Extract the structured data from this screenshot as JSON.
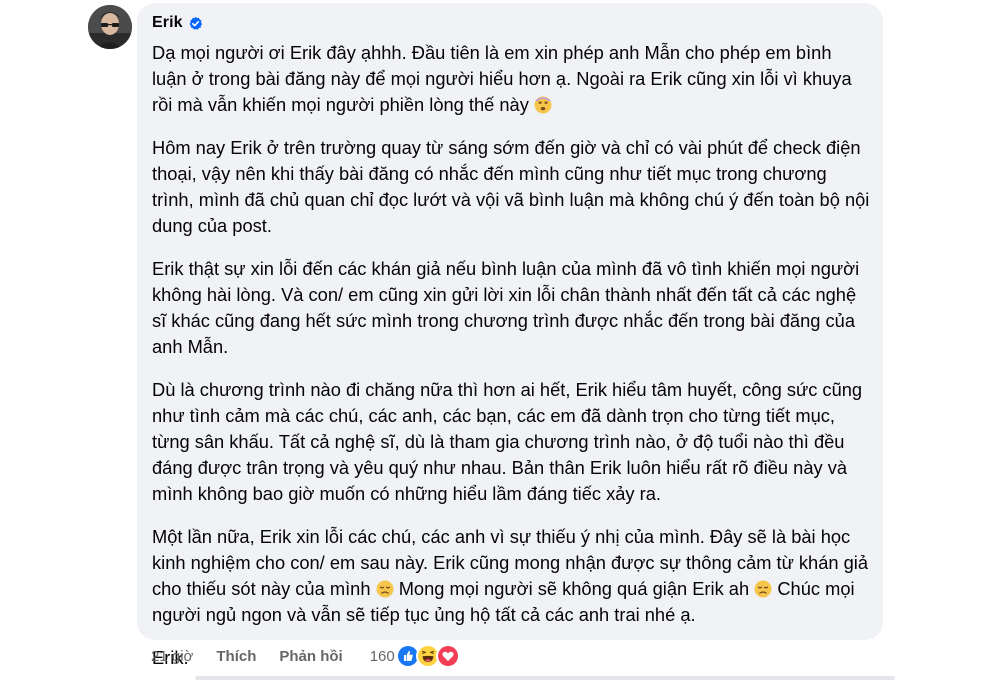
{
  "comment": {
    "author": "Erik",
    "verified": true,
    "paragraphs": {
      "p1": "Dạ mọi người ơi Erik đây ạhhh. Đầu tiên là em xin phép anh Mẫn cho phép em bình luận ở trong bài đăng này để mọi người hiểu hơn ạ. Ngoài ra Erik cũng xin lỗi vì khuya rồi mà vẫn khiến mọi người phiền lòng thế này",
      "p2": "Hôm nay Erik ở trên trường quay từ sáng sớm đến giờ và chỉ có vài phút để check điện thoại, vậy nên khi thấy bài đăng có nhắc đến mình cũng như tiết mục trong chương trình, mình đã chủ quan chỉ đọc lướt và vội vã bình luận mà không chú ý đến toàn bộ nội dung của post.",
      "p3": "Erik thật sự xin lỗi đến các khán giả nếu bình luận của mình đã vô tình khiến mọi người không hài lòng. Và con/ em cũng xin gửi lời xin lỗi chân thành nhất đến tất cả các nghệ sĩ khác cũng đang hết sức mình trong chương trình được nhắc đến trong bài đăng của anh Mẫn.",
      "p4": "Dù là chương trình nào đi chăng nữa thì hơn ai hết, Erik hiểu tâm huyết, công sức cũng như tình cảm mà các chú, các anh, các bạn, các em đã dành trọn cho từng tiết mục, từng sân khấu. Tất cả nghệ sĩ, dù là tham gia chương trình nào, ở độ tuổi nào thì đều đáng được trân trọng và yêu quý như nhau. Bản thân Erik luôn hiểu rất rõ điều này và mình không bao giờ muốn có những hiểu lầm đáng tiếc xảy ra.",
      "p5_a": "Một lần nữa, Erik xin lỗi các chú, các anh vì sự thiếu ý nhị của mình. Đây sẽ là bài học kinh nghiệm cho con/ em sau này. Erik cũng mong nhận được sự thông cảm từ khán giả cho thiếu sót này của mình",
      "p5_b": "Mong mọi người sẽ không quá giận Erik ah",
      "p5_c": "Chúc mọi người ngủ ngon và vẫn sẽ tiếp tục ủng hộ tất cả các anh trai nhé ạ.",
      "p6": "Erik."
    },
    "emojis": [
      "face-with-spiral-eyes",
      "disappointed-face",
      "disappointed-face"
    ]
  },
  "actions": {
    "timestamp": "21 giờ",
    "like": "Thích",
    "reply": "Phản hồi",
    "reaction_count": "160",
    "reactions": [
      "like-icon",
      "laughing-icon",
      "love-icon"
    ]
  },
  "colors": {
    "bubble": "#f0f2f5",
    "text": "#050505",
    "meta": "#65676b",
    "verified": "#0866ff",
    "like": "#1877f2",
    "love": "#f33e58",
    "haha": "#fcd240"
  }
}
